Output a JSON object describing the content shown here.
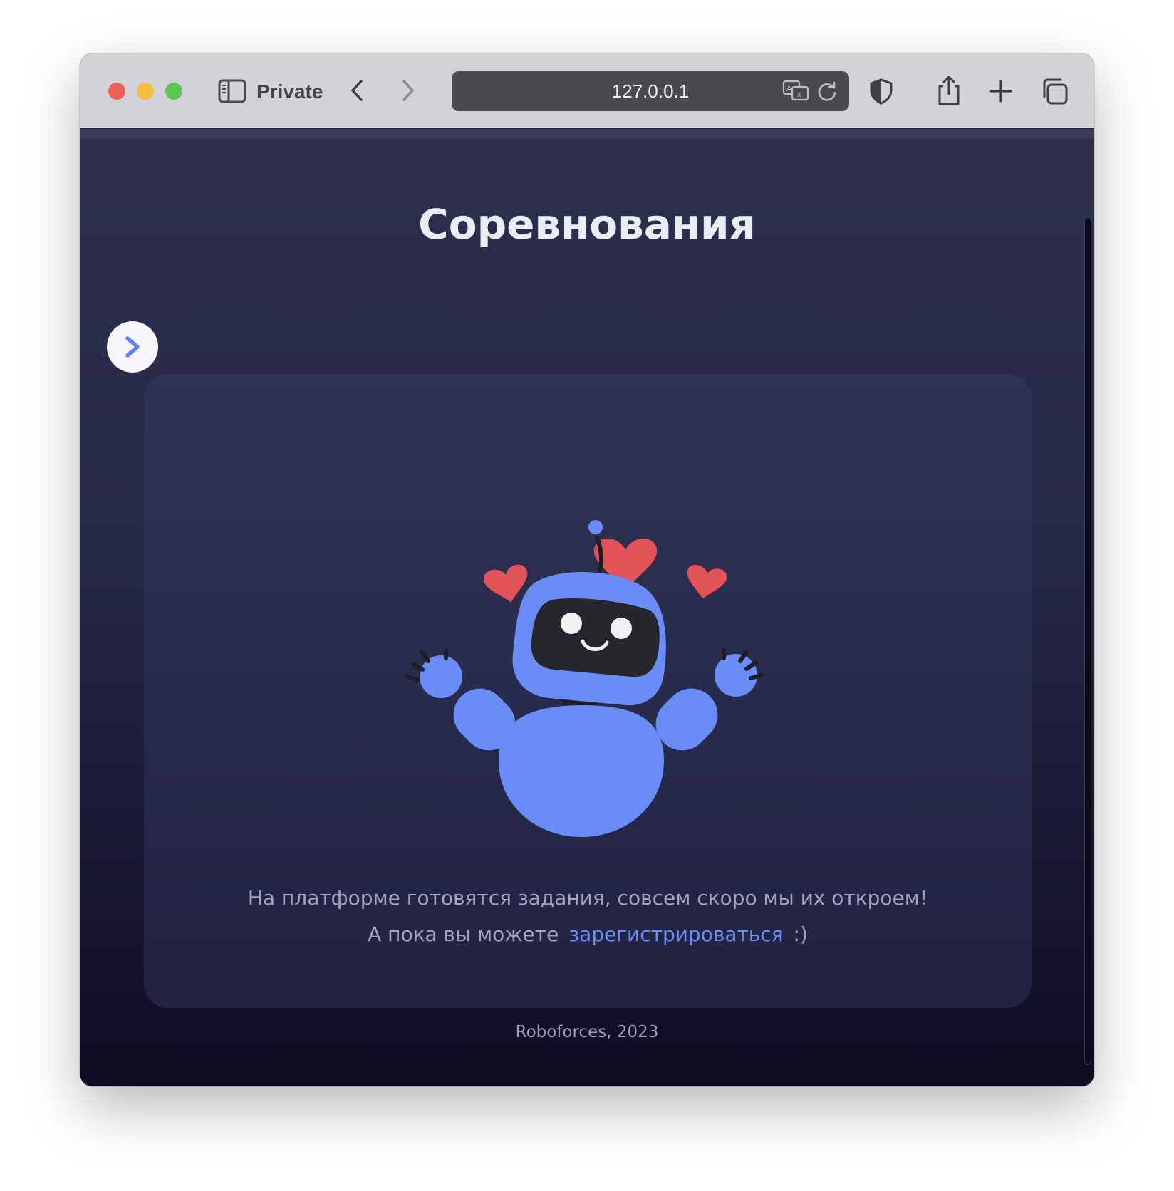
{
  "browser": {
    "private_label": "Private",
    "address": "127.0.0.1"
  },
  "page": {
    "title": "Соревнования",
    "message_line1": "На платформе готовятся задания, совсем скоро мы их откроем!",
    "message_line2_prefix": "А пока вы можете",
    "register_link": "зарегистрироваться",
    "message_line2_suffix": ":)",
    "footer": "Roboforces, 2023"
  },
  "colors": {
    "accent": "#6a8cf6",
    "robot_blue": "#6a8cf6",
    "heart_red": "#e25357",
    "background_top": "#2e2f4f",
    "background_bottom": "#0f0b23"
  }
}
